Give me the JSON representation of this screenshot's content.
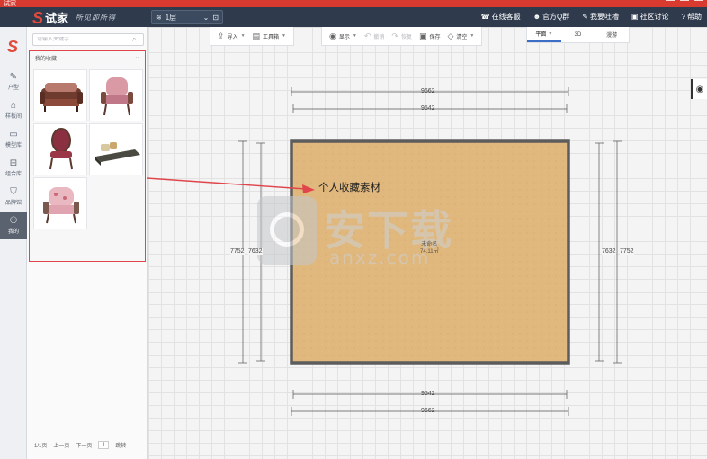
{
  "window": {
    "title": "试家"
  },
  "header": {
    "brand": "试家",
    "slogan": "所见即所得",
    "floor": {
      "icon": "layers-icon",
      "value": "1层"
    },
    "links": [
      {
        "name": "online-service",
        "icon": "headset-icon",
        "label": "在线客服"
      },
      {
        "name": "official-qq",
        "icon": "user-icon",
        "label": "官方Q群"
      },
      {
        "name": "feedback",
        "icon": "mic-icon",
        "label": "我要吐槽"
      },
      {
        "name": "community",
        "icon": "chat-icon",
        "label": "社区讨论"
      },
      {
        "name": "help",
        "icon": "question-icon",
        "label": "帮助"
      }
    ]
  },
  "rail": {
    "items": [
      {
        "name": "house-type",
        "icon": "pencil-icon",
        "label": "户型"
      },
      {
        "name": "sample-room",
        "icon": "home-icon",
        "label": "样板间"
      },
      {
        "name": "model-library",
        "icon": "sofa-icon",
        "label": "模型库"
      },
      {
        "name": "combo-library",
        "icon": "combo-icon",
        "label": "组合库"
      },
      {
        "name": "brand-hall",
        "icon": "shield-icon",
        "label": "品牌馆"
      },
      {
        "name": "mine",
        "icon": "person-icon",
        "label": "我的",
        "active": true
      }
    ]
  },
  "panel": {
    "search_placeholder": "请输入关键字",
    "section_title": "我的收藏",
    "items": [
      {
        "name": "classic-sofa",
        "kind": "sofa"
      },
      {
        "name": "pink-armchair",
        "kind": "armchair"
      },
      {
        "name": "oval-back-chair",
        "kind": "oval-chair"
      },
      {
        "name": "chaise-lounge",
        "kind": "lounge"
      },
      {
        "name": "floral-armchair",
        "kind": "floral-chair"
      }
    ],
    "pager": {
      "page_info": "1/1页",
      "prev": "上一页",
      "next": "下一页",
      "page_input": "1",
      "jump": "跳转"
    }
  },
  "toolbar": {
    "groups": [
      [
        {
          "name": "import",
          "icon": "upload-icon",
          "label": "导入",
          "dropdown": true
        },
        {
          "name": "toolbox",
          "icon": "toolbox-icon",
          "label": "工具箱",
          "dropdown": true
        }
      ],
      [
        {
          "name": "display",
          "icon": "eye-icon",
          "label": "显示",
          "dropdown": true
        },
        {
          "name": "undo",
          "icon": "undo-icon",
          "label": "撤销",
          "disabled": true
        },
        {
          "name": "redo",
          "icon": "redo-icon",
          "label": "恢复",
          "disabled": true
        },
        {
          "name": "save",
          "icon": "save-icon",
          "label": "保存"
        },
        {
          "name": "clear",
          "icon": "clear-icon",
          "label": "清空",
          "dropdown": true
        }
      ]
    ],
    "views": [
      {
        "name": "plan",
        "label": "平面",
        "active": true,
        "dropdown": true
      },
      {
        "name": "3d",
        "label": "3D"
      },
      {
        "name": "roam",
        "label": "漫游"
      }
    ]
  },
  "plan": {
    "dimensions": {
      "outer_width": "9662",
      "inner_width": "9542",
      "outer_height": "7752",
      "inner_height": "7632"
    },
    "room": {
      "name": "未命名",
      "area": "74.11㎡"
    },
    "annotation": "个人收藏素材",
    "colors": {
      "floor": "#e0b77c",
      "wall": "#5c5c5c",
      "annotation_arrow": "#e0454b",
      "highlight": "#e0454b"
    }
  },
  "watermark": {
    "cn": "安下载",
    "en": "anxz.com"
  }
}
